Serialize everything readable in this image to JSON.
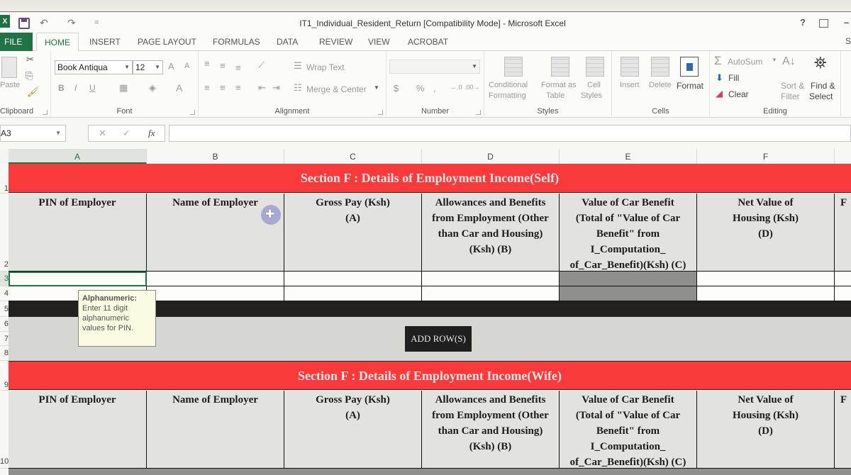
{
  "window": {
    "title": "IT1_Individual_Resident_Return  [Compatibility Mode] - Microsoft Excel",
    "help": "?",
    "minimize": "–"
  },
  "quick_access": {
    "app_icon": "X",
    "undo": "↶",
    "redo": "↷",
    "customize": "="
  },
  "tabs": [
    {
      "label": "FILE"
    },
    {
      "label": "HOME"
    },
    {
      "label": "INSERT"
    },
    {
      "label": "PAGE LAYOUT"
    },
    {
      "label": "FORMULAS"
    },
    {
      "label": "DATA"
    },
    {
      "label": "REVIEW"
    },
    {
      "label": "VIEW"
    },
    {
      "label": "ACROBAT"
    }
  ],
  "tab_overflow": "S",
  "ribbon": {
    "clipboard": {
      "label": "Clipboard",
      "paste": "Paste"
    },
    "font": {
      "label": "Font",
      "font_name": "Book Antiqua",
      "font_size": "12",
      "bold": "B",
      "italic": "I",
      "underline": "U",
      "grow": "A",
      "shrink": "A",
      "font_color": "A"
    },
    "alignment": {
      "label": "Alignment",
      "wrap_text": "Wrap Text",
      "merge_center": "Merge & Center"
    },
    "number": {
      "label": "Number",
      "format": "",
      "currency": "$",
      "percent": "%",
      "comma": ",",
      "inc_decimal": "←.0",
      "dec_decimal": ".00→"
    },
    "styles": {
      "label": "Styles",
      "conditional": "Conditional",
      "conditional2": "Formatting",
      "format_as": "Format as",
      "format_as2": "Table",
      "cell": "Cell",
      "cell2": "Styles"
    },
    "cells": {
      "label": "Cells",
      "insert": "Insert",
      "delete": "Delete",
      "format": "Format"
    },
    "editing": {
      "label": "Editing",
      "autosum": "AutoSum",
      "fill": "Fill",
      "clear": "Clear",
      "sort": "Sort &",
      "sort2": "Filter",
      "find": "Find &",
      "find2": "Select"
    }
  },
  "formula_bar": {
    "name_box": "A3",
    "cancel": "✕",
    "enter": "✓",
    "fx": "fx",
    "value": ""
  },
  "columns": [
    "A",
    "B",
    "C",
    "D",
    "E",
    "F"
  ],
  "rows": [
    "1",
    "2",
    "3",
    "4",
    "5",
    "6",
    "7",
    "8",
    "9",
    "10"
  ],
  "sections": [
    {
      "title": "Section F : Details of Employment Income(Self)",
      "headers": [
        "PIN of Employer",
        "Name of Employer",
        "Gross Pay (Ksh)\n(A)",
        "Allowances and Benefits\nfrom Employment (Other\nthan Car and Housing)\n(Ksh) (B)",
        "Value of Car Benefit\n(Total of \"Value of Car\nBenefit\" from\nI_Computation_\nof_Car_Benefit)(Ksh) (C)",
        "Net Value of\nHousing (Ksh)\n(D)",
        "F"
      ]
    },
    {
      "title": "Section F : Details of Employment Income(Wife)",
      "headers": [
        "PIN of Employer",
        "Name of Employer",
        "Gross Pay (Ksh)\n(A)",
        "Allowances and Benefits\nfrom Employment (Other\nthan Car and Housing)\n(Ksh) (B)",
        "Value of Car Benefit\n(Total of \"Value of Car\nBenefit\" from\nI_Computation_\nof_Car_Benefit)(Ksh) (C)",
        "Net Value of\nHousing (Ksh)\n(D)",
        "F"
      ]
    }
  ],
  "add_rows_button": "ADD ROW(S)",
  "tooltip": {
    "title": "Alphanumeric:",
    "body": "Enter 11 digit alphanumeric values for PIN."
  },
  "colors": {
    "banner": "#f93a3a",
    "excel_green": "#217346",
    "header_fill": "#e2e2df",
    "locked_cell": "#8f8f8c"
  }
}
